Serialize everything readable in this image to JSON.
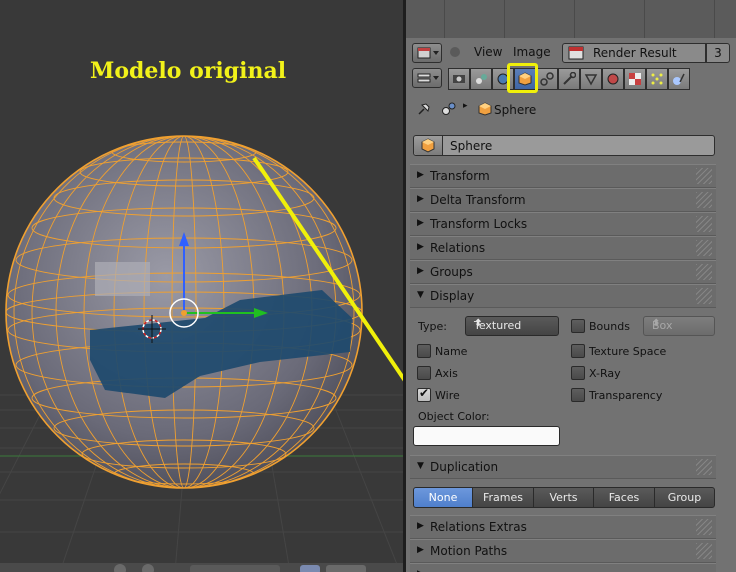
{
  "viewport": {
    "annotation_title": "Modelo original"
  },
  "image_editor_header": {
    "menus": [
      "View",
      "Image"
    ],
    "image_name": "Render Result",
    "user_count": "3"
  },
  "properties": {
    "breadcrumb_object": "Sphere",
    "object_name": "Sphere",
    "sections_top": [
      {
        "label": "Transform",
        "expanded": false
      },
      {
        "label": "Delta Transform",
        "expanded": false
      },
      {
        "label": "Transform Locks",
        "expanded": false
      },
      {
        "label": "Relations",
        "expanded": false
      },
      {
        "label": "Groups",
        "expanded": false
      }
    ],
    "display": {
      "header": "Display",
      "type_label": "Type:",
      "type_value": "Textured",
      "bounds_label": "Bounds",
      "bounds_type": "Box",
      "checkboxes": {
        "name": {
          "label": "Name",
          "checked": false
        },
        "axis": {
          "label": "Axis",
          "checked": false
        },
        "wire": {
          "label": "Wire",
          "checked": true
        },
        "texture_space": {
          "label": "Texture Space",
          "checked": false
        },
        "xray": {
          "label": "X-Ray",
          "checked": false
        },
        "transparency": {
          "label": "Transparency",
          "checked": false
        },
        "bounds": {
          "checked": false
        }
      },
      "object_color_label": "Object Color:",
      "object_color": "#fafafa"
    },
    "duplication": {
      "header": "Duplication",
      "options": [
        "None",
        "Frames",
        "Verts",
        "Faces",
        "Group"
      ],
      "selected": "None"
    },
    "sections_bottom": [
      {
        "label": "Relations Extras",
        "expanded": false
      },
      {
        "label": "Motion Paths",
        "expanded": false
      }
    ]
  },
  "colors": {
    "highlight_yellow": "#f0f00a",
    "selection_orange": "#f0a030",
    "active_blue": "#4f7fcc"
  },
  "icons": [
    "pin-icon",
    "scene-icon",
    "object-cube-icon",
    "render-tab-icon",
    "scene-tab-icon",
    "world-tab-icon",
    "object-tab-icon",
    "constraints-tab-icon",
    "modifiers-tab-icon",
    "data-tab-icon",
    "material-tab-icon",
    "texture-tab-icon",
    "particles-tab-icon",
    "physics-tab-icon"
  ]
}
